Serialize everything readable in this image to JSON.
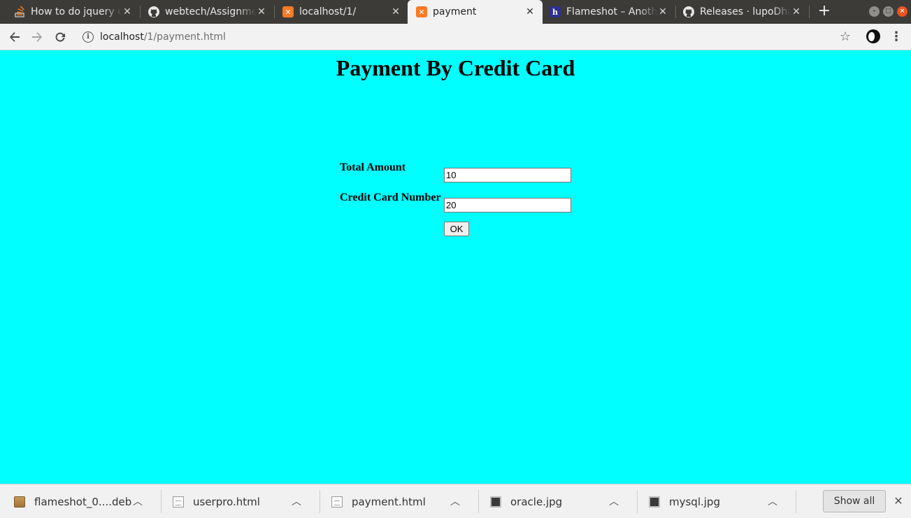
{
  "tabs": [
    {
      "title": "How to do jquery c",
      "icon": "stackoverflow-icon",
      "active": false
    },
    {
      "title": "webtech/Assignme",
      "icon": "github-icon",
      "active": false
    },
    {
      "title": "localhost/1/",
      "icon": "xampp-icon",
      "active": false
    },
    {
      "title": "payment",
      "icon": "xampp-icon",
      "active": true
    },
    {
      "title": "Flameshot – Anoth",
      "icon": "hashnode-icon",
      "active": false
    },
    {
      "title": "Releases · lupoDha",
      "icon": "github-icon",
      "active": false
    }
  ],
  "address": {
    "host": "localhost",
    "path": "/1/payment.html"
  },
  "page": {
    "title": "Payment By Credit Card",
    "total_amount_label": "Total Amount",
    "total_amount_value": "10",
    "card_number_label": "Credit Card Number",
    "card_number_value": "20",
    "ok_label": "OK",
    "background": "#00ffff"
  },
  "downloads": [
    {
      "name": "flameshot_0....deb",
      "icon": "package-icon"
    },
    {
      "name": "userpro.html",
      "icon": "html-file-icon"
    },
    {
      "name": "payment.html",
      "icon": "html-file-icon"
    },
    {
      "name": "oracle.jpg",
      "icon": "image-file-icon"
    },
    {
      "name": "mysql.jpg",
      "icon": "image-file-icon"
    }
  ],
  "shelf": {
    "show_all_label": "Show all"
  }
}
